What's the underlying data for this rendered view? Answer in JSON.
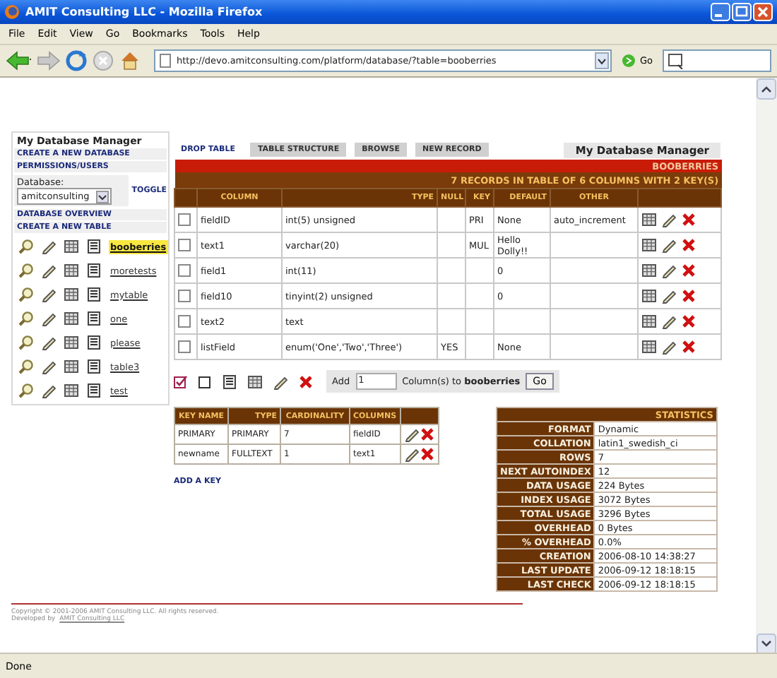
{
  "window": {
    "title": "AMIT Consulting LLC - Mozilla Firefox"
  },
  "menu": [
    "File",
    "Edit",
    "View",
    "Go",
    "Bookmarks",
    "Tools",
    "Help"
  ],
  "address": {
    "url": "http://devo.amitconsulting.com/platform/database/?table=booberries",
    "go": "Go"
  },
  "sidebar": {
    "title": "My Database Manager",
    "links": [
      "CREATE A NEW DATABASE",
      "PERMISSIONS/USERS"
    ],
    "database_label": "Database:",
    "database": "amitconsulting",
    "toggle": "TOGGLE",
    "links2": [
      "DATABASE OVERVIEW",
      "CREATE A NEW TABLE"
    ],
    "tables": [
      {
        "name": "booberries",
        "selected": true
      },
      {
        "name": "moretests",
        "selected": false
      },
      {
        "name": "mytable",
        "selected": false
      },
      {
        "name": "one",
        "selected": false
      },
      {
        "name": "please",
        "selected": false
      },
      {
        "name": "table3",
        "selected": false
      },
      {
        "name": "test",
        "selected": false
      }
    ]
  },
  "tabs": [
    {
      "label": "DROP TABLE",
      "kind": "link"
    },
    {
      "label": "TABLE STRUCTURE",
      "kind": "button"
    },
    {
      "label": "BROWSE",
      "kind": "button"
    },
    {
      "label": "NEW RECORD",
      "kind": "button"
    },
    {
      "label": "My Database Manager",
      "kind": "heading"
    }
  ],
  "structure": {
    "title": "BOOBERRIES",
    "summary": "7 RECORDS IN TABLE OF 6 COLUMNS WITH 2 KEY(S)",
    "columns": [
      "COLUMN",
      "TYPE",
      "NULL",
      "KEY",
      "DEFAULT",
      "OTHER"
    ],
    "rows": [
      {
        "checked": false,
        "cells": [
          "fieldID",
          "int(5) unsigned",
          "",
          "PRI",
          "None",
          "auto_increment"
        ]
      },
      {
        "checked": false,
        "cells": [
          "text1",
          "varchar(20)",
          "",
          "MUL",
          "Hello Dolly!!",
          ""
        ]
      },
      {
        "checked": false,
        "cells": [
          "field1",
          "int(11)",
          "",
          "",
          "0",
          ""
        ]
      },
      {
        "checked": false,
        "cells": [
          "field10",
          "tinyint(2) unsigned",
          "",
          "",
          "0",
          ""
        ]
      },
      {
        "checked": false,
        "cells": [
          "text2",
          "text",
          "",
          "",
          "",
          ""
        ]
      },
      {
        "checked": false,
        "cells": [
          "listField",
          "enum('One','Two','Three')",
          "YES",
          "",
          "None",
          ""
        ]
      }
    ]
  },
  "add_bar": {
    "label": "Add",
    "count": "1",
    "suffix": "Column(s) to **booberries**",
    "go": "Go"
  },
  "keys": {
    "columns": [
      "KEY NAME",
      "TYPE",
      "CARDINALITY",
      "COLUMNS"
    ],
    "rows": [
      [
        "PRIMARY",
        "PRIMARY",
        "7",
        "fieldID"
      ],
      [
        "newname",
        "FULLTEXT",
        "1",
        "text1"
      ]
    ]
  },
  "add_key": "ADD A KEY",
  "statistics": {
    "title": "STATISTICS",
    "rows": [
      [
        "FORMAT",
        "Dynamic"
      ],
      [
        "COLLATION",
        "latin1_swedish_ci"
      ],
      [
        "ROWS",
        "7"
      ],
      [
        "NEXT AUTOINDEX",
        "12"
      ],
      [
        "DATA USAGE",
        "224 Bytes"
      ],
      [
        "INDEX USAGE",
        "3072 Bytes"
      ],
      [
        "TOTAL USAGE",
        "3296 Bytes"
      ],
      [
        "OVERHEAD",
        "0 Bytes"
      ],
      [
        "% OVERHEAD",
        "0.0%"
      ],
      [
        "CREATION",
        "2006-08-10 14:38:27"
      ],
      [
        "LAST UPDATE",
        "2006-09-12 18:18:15"
      ],
      [
        "LAST CHECK",
        "2006-09-12 18:18:15"
      ]
    ]
  },
  "footer": {
    "copyright": "Copyright © 2001-2006 AMIT Consulting LLC. All rights reserved.",
    "developed": "Developed by",
    "developer": "AMIT Consulting LLC"
  },
  "status_bar": "Done"
}
